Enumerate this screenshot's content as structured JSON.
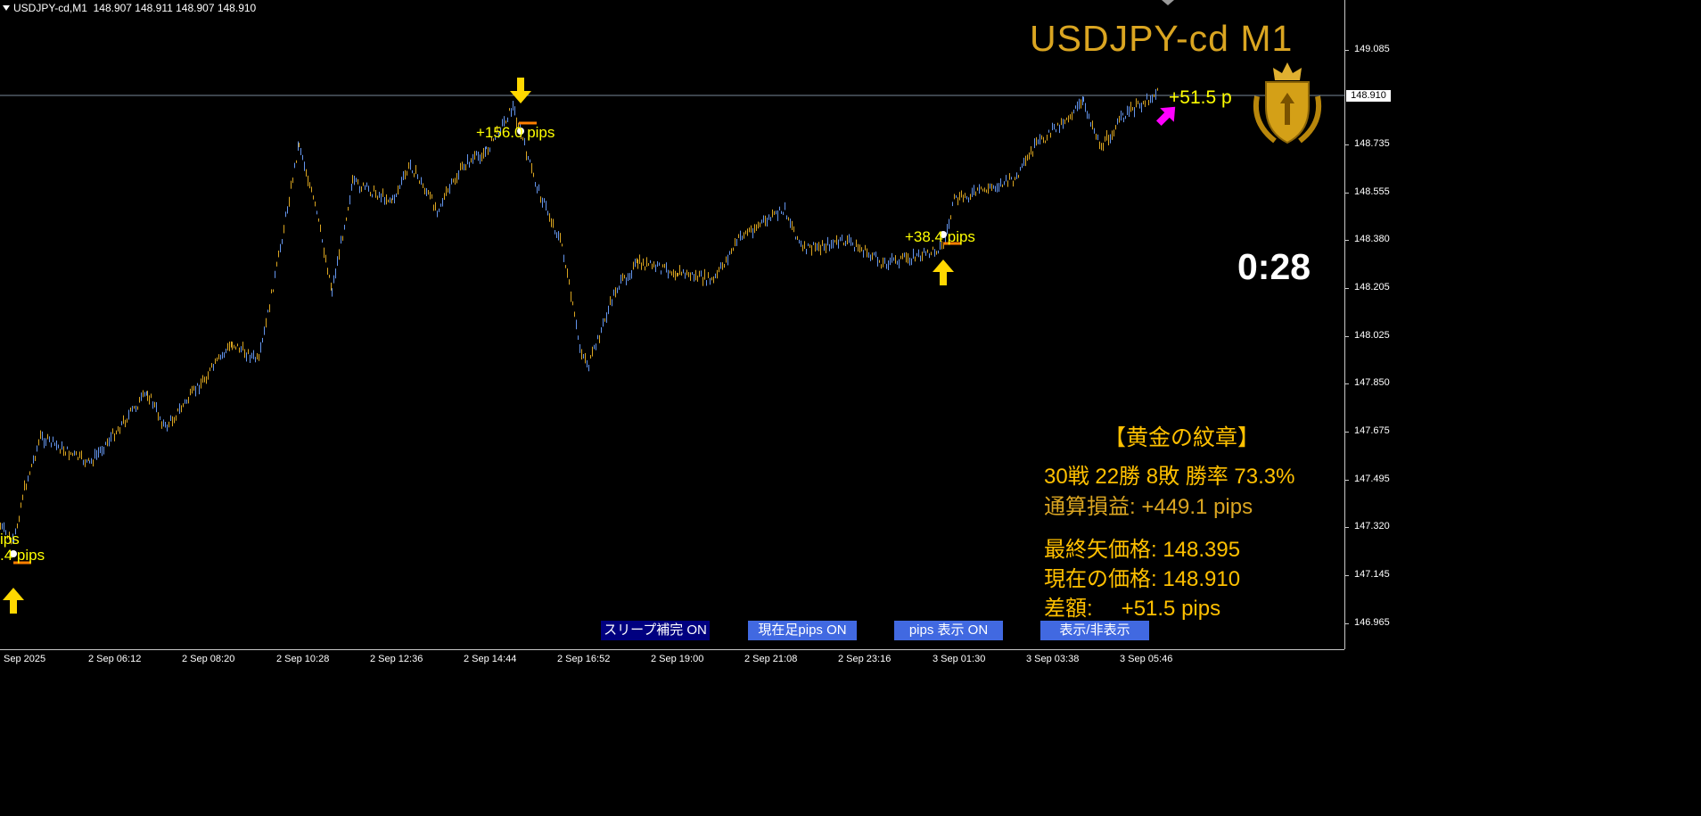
{
  "header": {
    "symbol_timeframe": "USDJPY-cd,M1",
    "ohlc": "148.907 148.911 148.907 148.910"
  },
  "overlay": {
    "symbol_title": "USDJPY-cd M1",
    "countdown": "0:28"
  },
  "price_axis": {
    "ticks": [
      "149.085",
      "148.910",
      "148.735",
      "148.555",
      "148.380",
      "148.205",
      "148.025",
      "147.850",
      "147.675",
      "147.495",
      "147.320",
      "147.145",
      "146.965"
    ],
    "current_price": "148.910"
  },
  "time_axis": {
    "ticks": [
      "Sep 2025",
      "2 Sep 06:12",
      "2 Sep 08:20",
      "2 Sep 10:28",
      "2 Sep 12:36",
      "2 Sep 14:44",
      "2 Sep 16:52",
      "2 Sep 19:00",
      "2 Sep 21:08",
      "2 Sep 23:16",
      "3 Sep 01:30",
      "3 Sep 03:38",
      "3 Sep 05:46"
    ]
  },
  "signals": {
    "left_partial_top": "ips",
    "left_partial_bottom": ".4 pips",
    "sell_peak": "+156.0 pips",
    "buy_mid": "+38.4 pips",
    "current_open": "+51.5 p"
  },
  "stats_panel": {
    "title": "【黄金の紋章】",
    "record": "30戦 22勝 8敗  勝率 73.3%",
    "total_pl": "通算損益:  +449.1 pips",
    "last_arrow_price_label": "最終矢価格:",
    "last_arrow_price": "148.395",
    "current_price_label": "現在の価格:",
    "current_price": "148.910",
    "diff_label": "差額:",
    "diff_value": "+51.5 pips"
  },
  "buttons": {
    "sleep": "スリープ補完 ON",
    "current_bar": "現在足pips ON",
    "pips_display": "pips 表示  ON",
    "show_hide": "表示/非表示"
  },
  "colors": {
    "background": "#000000",
    "price_line": "#778899",
    "candle_up": "#6495ed",
    "candle_down": "#daa520",
    "signal_arrow": "#ffd700",
    "current_arrow": "#ff00ff",
    "pips_text": "#ffff00",
    "panel_text": "#ffc000",
    "title_gold": "#daa521",
    "button_off": "#4169e1",
    "button_active": "#000080"
  },
  "icons": {
    "emblem": "gold-crest-emblem-icon",
    "buy": "arrow-up-icon",
    "sell": "arrow-down-icon",
    "current": "arrow-up-right-icon"
  }
}
